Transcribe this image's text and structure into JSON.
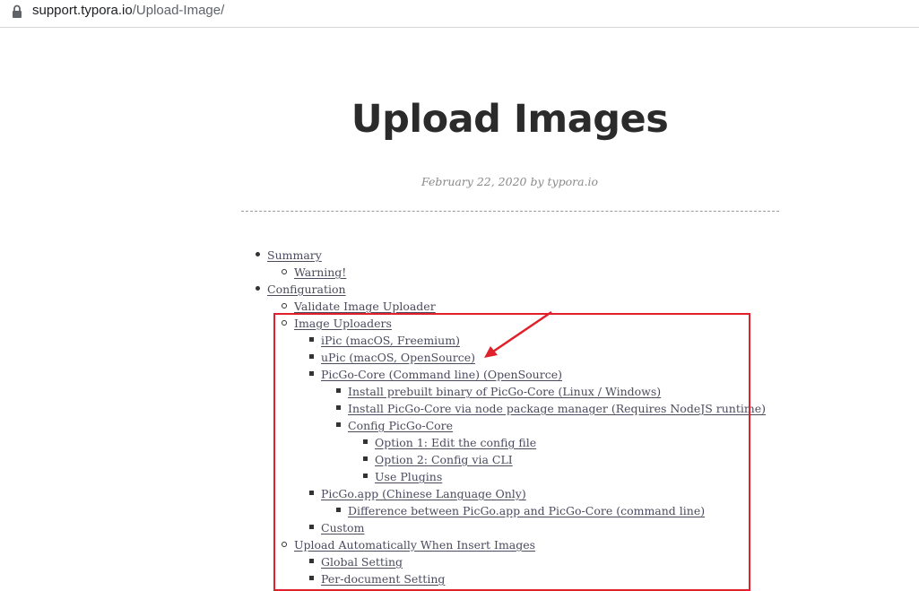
{
  "browser": {
    "url_host": "support.typora.io",
    "url_path": "/Upload-Image/"
  },
  "article": {
    "title": "Upload Images",
    "meta": "February 22, 2020 by typora.io"
  },
  "toc": [
    {
      "level": 1,
      "label": "Summary"
    },
    {
      "level": 2,
      "label": "Warning!"
    },
    {
      "level": 1,
      "label": "Configuration"
    },
    {
      "level": 2,
      "label": "Validate Image Uploader"
    },
    {
      "level": 2,
      "label": "Image Uploaders"
    },
    {
      "level": 3,
      "label": "iPic (macOS, Freemium)"
    },
    {
      "level": 3,
      "label": "uPic (macOS, OpenSource)"
    },
    {
      "level": 3,
      "label": "PicGo-Core (Command line) (OpenSource)"
    },
    {
      "level": 4,
      "label": "Install prebuilt binary of PicGo-Core (Linux / Windows)"
    },
    {
      "level": 4,
      "label": "Install PicGo-Core via node package manager (Requires NodeJS runtime)"
    },
    {
      "level": 4,
      "label": "Config PicGo-Core"
    },
    {
      "level": 5,
      "label": "Option 1: Edit the config file"
    },
    {
      "level": 5,
      "label": "Option 2: Config via CLI"
    },
    {
      "level": 5,
      "label": "Use Plugins"
    },
    {
      "level": 3,
      "label": "PicGo.app (Chinese Language Only)"
    },
    {
      "level": 4,
      "label": "Difference between PicGo.app and PicGo-Core (command line)"
    },
    {
      "level": 3,
      "label": "Custom"
    },
    {
      "level": 2,
      "label": "Upload Automatically When Insert Images"
    },
    {
      "level": 3,
      "label": "Global Setting"
    },
    {
      "level": 3,
      "label": "Per-document Setting"
    }
  ],
  "annotation": {
    "color": "#e0202a",
    "icon": "arrow-icon"
  }
}
